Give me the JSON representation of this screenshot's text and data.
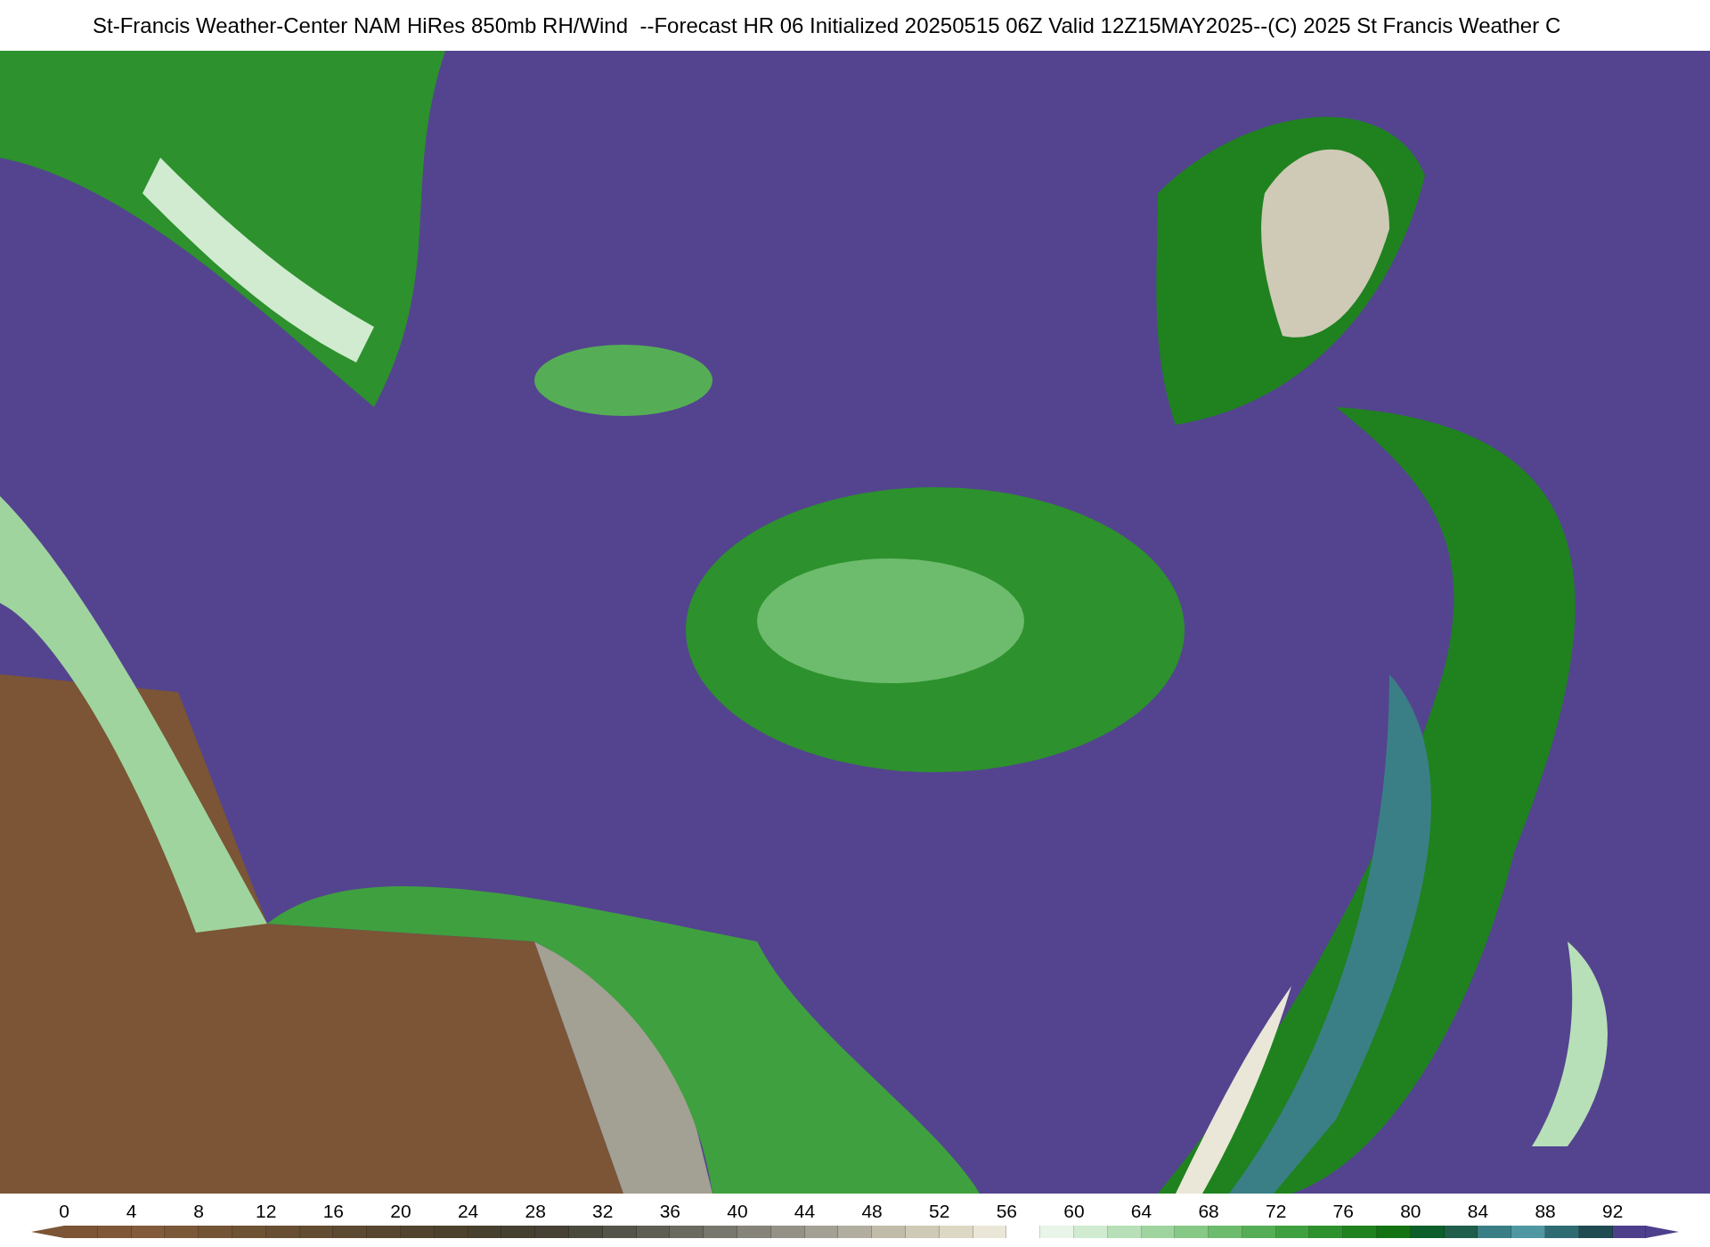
{
  "title": "St-Francis Weather-Center NAM HiRes 850mb RH/Wind  --Forecast HR 06 Initialized 20250515 06Z Valid 12Z15MAY2025--(C) 2025 St Francis Weather C",
  "colorbar": {
    "segments": [
      {
        "color": "#7b5535"
      },
      {
        "color": "#7e5838"
      },
      {
        "color": "#815b3b"
      },
      {
        "color": "#7a5838"
      },
      {
        "color": "#735536"
      },
      {
        "color": "#6d5234"
      },
      {
        "color": "#684f33"
      },
      {
        "color": "#624c32"
      },
      {
        "color": "#5c4931"
      },
      {
        "color": "#574630"
      },
      {
        "color": "#52432e"
      },
      {
        "color": "#4d412d"
      },
      {
        "color": "#48402e"
      },
      {
        "color": "#45402f"
      },
      {
        "color": "#454134"
      },
      {
        "color": "#4b4a3f"
      },
      {
        "color": "#55544a"
      },
      {
        "color": "#5f5e55"
      },
      {
        "color": "#6b6a61"
      },
      {
        "color": "#78776d"
      },
      {
        "color": "#86847a"
      },
      {
        "color": "#949287"
      },
      {
        "color": "#a3a094"
      },
      {
        "color": "#b2ae9f"
      },
      {
        "color": "#c1bcaa"
      },
      {
        "color": "#cfcab6"
      },
      {
        "color": "#ddd8c4"
      },
      {
        "color": "#ebe7d8"
      },
      {
        "color": "#ffffff"
      },
      {
        "color": "#e8f5e8"
      },
      {
        "color": "#d0ebd0"
      },
      {
        "color": "#b8e0b8"
      },
      {
        "color": "#9fd49f"
      },
      {
        "color": "#86c886"
      },
      {
        "color": "#6dbb6d"
      },
      {
        "color": "#55ae55"
      },
      {
        "color": "#3fa03f"
      },
      {
        "color": "#2d912d"
      },
      {
        "color": "#1f821f"
      },
      {
        "color": "#137313"
      },
      {
        "color": "#0c5e2a"
      },
      {
        "color": "#1f5e4a"
      },
      {
        "color": "#3a7f86"
      },
      {
        "color": "#4f98a3"
      },
      {
        "color": "#2f6b73"
      },
      {
        "color": "#1f4a52"
      },
      {
        "color": "#4e3f8c"
      }
    ],
    "ticks": [
      "0",
      "4",
      "8",
      "12",
      "16",
      "20",
      "24",
      "28",
      "32",
      "36",
      "40",
      "44",
      "48",
      "52",
      "56",
      "60",
      "64",
      "68",
      "72",
      "76",
      "80",
      "84",
      "88",
      "92"
    ]
  }
}
